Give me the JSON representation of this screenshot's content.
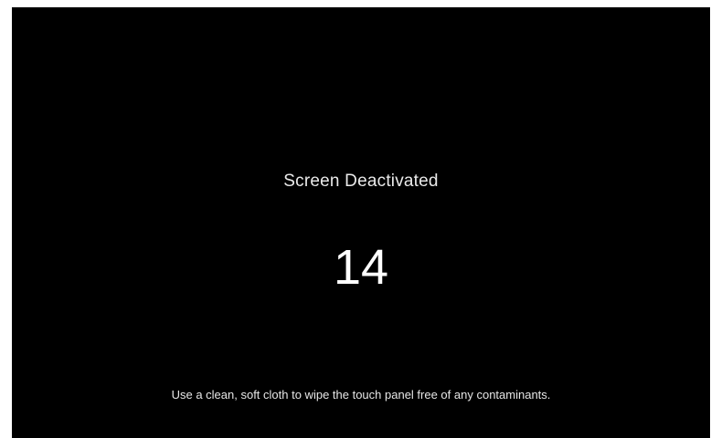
{
  "screen": {
    "title": "Screen Deactivated",
    "countdown": "14",
    "hint": "Use a clean, soft cloth to wipe the touch panel free of any contaminants.",
    "background_color": "#000000",
    "text_color": "#ffffff"
  }
}
